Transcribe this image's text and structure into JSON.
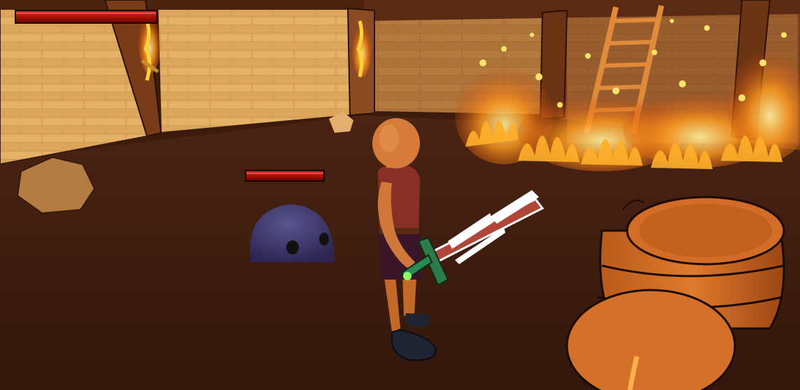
{
  "hud": {
    "player_health": {
      "value": 1.0
    },
    "enemy_health": {
      "value": 1.0
    }
  },
  "colors": {
    "floor": "#4a2414",
    "wall_brick": "#d9a35a",
    "wood": "#8a4a22",
    "fire": "#ff8a1a",
    "slime": "#3b3566",
    "health_bar": "#b51409"
  },
  "scene": {
    "objects": [
      "stone-brick-wall",
      "wooden-pillar",
      "wall-torch",
      "wooden-ladder",
      "fire-hazard",
      "boulder",
      "purple-slime-enemy",
      "player-character",
      "player-sword",
      "wooden-barrel"
    ]
  }
}
